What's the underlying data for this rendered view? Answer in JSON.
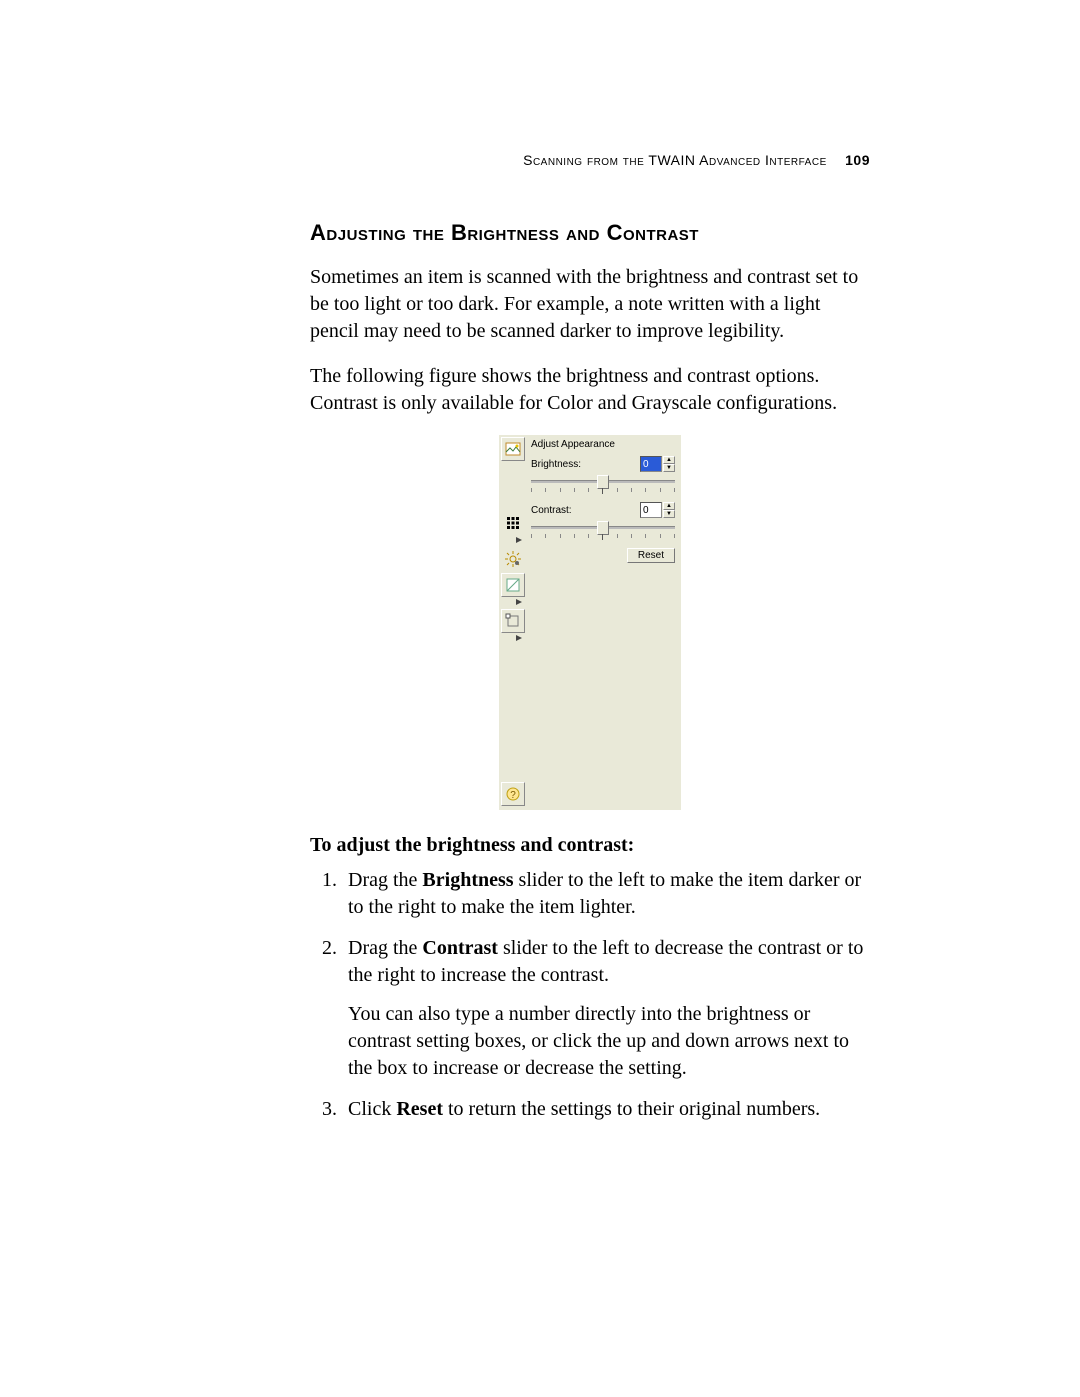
{
  "header": {
    "chapter": "Scanning from the TWAIN Advanced Interface",
    "page_number": "109"
  },
  "section": {
    "title": "Adjusting the Brightness and Contrast"
  },
  "paragraphs": {
    "p1": "Sometimes an item is scanned with the brightness and contrast set to be too light or too dark. For example, a note written with a light pencil may need to be scanned darker to improve legibility.",
    "p2": "The following figure shows the brightness and contrast options. Contrast is only available for Color and Grayscale configurations."
  },
  "figure": {
    "panel_title": "Adjust Appearance",
    "brightness_label": "Brightness:",
    "brightness_value": "0",
    "contrast_label": "Contrast:",
    "contrast_value": "0",
    "reset_label": "Reset",
    "icons": {
      "image": "image-icon",
      "grid": "grid-icon",
      "brightness": "sun-icon",
      "sharpen": "sharpen-icon",
      "crop": "crop-icon",
      "help": "help-icon"
    }
  },
  "procedure": {
    "heading": "To adjust the brightness and contrast:",
    "steps": {
      "s1_pre": "Drag the ",
      "s1_bold": "Brightness",
      "s1_post": " slider to the left to make the item darker or to the right to make the item lighter.",
      "s2_pre": "Drag the ",
      "s2_bold": "Contrast",
      "s2_post": " slider to the left to decrease the contrast or to the right to increase the contrast.",
      "s2_follow": "You can also type a number directly into the brightness or contrast setting boxes, or click the up and down arrows next to the box to increase or decrease the setting.",
      "s3_pre": "Click ",
      "s3_bold": "Reset",
      "s3_post": " to return the settings to their original numbers."
    }
  }
}
